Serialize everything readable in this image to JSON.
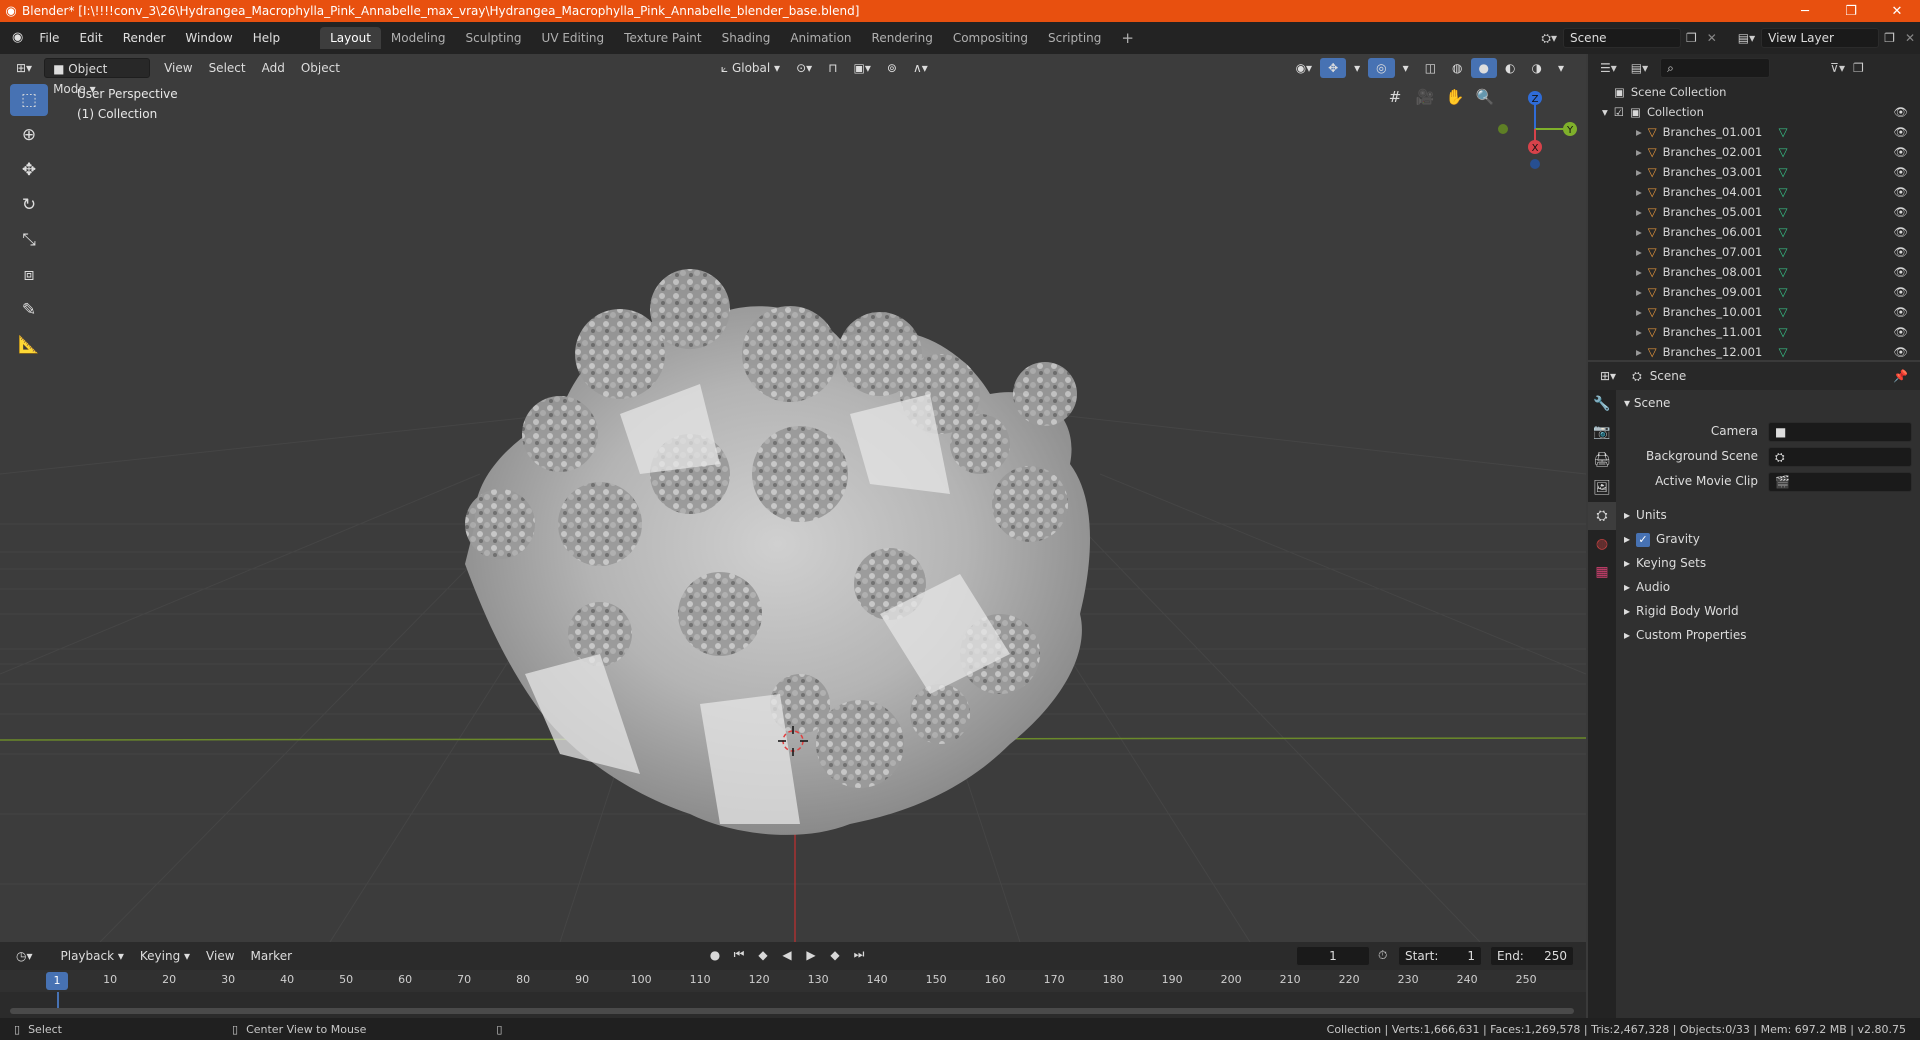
{
  "titlebar": {
    "title": "Blender* [I:\\!!!!conv_3\\26\\Hydrangea_Macrophylla_Pink_Annabelle_max_vray\\Hydrangea_Macrophylla_Pink_Annabelle_blender_base.blend]",
    "accent": "#e8500f"
  },
  "menu": {
    "file": "File",
    "edit": "Edit",
    "render": "Render",
    "window": "Window",
    "help": "Help"
  },
  "workspaces": [
    "Layout",
    "Modeling",
    "Sculpting",
    "UV Editing",
    "Texture Paint",
    "Shading",
    "Animation",
    "Rendering",
    "Compositing",
    "Scripting"
  ],
  "scene_field": "Scene",
  "view_layer_field": "View Layer",
  "viewport": {
    "mode": "Object Mode",
    "view": "View",
    "select": "Select",
    "add": "Add",
    "object": "Object",
    "transform_orientation": "Global",
    "perspective": "User Perspective",
    "collection": "(1) Collection",
    "axes": {
      "x": "X",
      "y": "Y",
      "z": "Z"
    }
  },
  "outliner": {
    "scene_collection": "Scene Collection",
    "collection": "Collection",
    "items": [
      "Branches_01.001",
      "Branches_02.001",
      "Branches_03.001",
      "Branches_04.001",
      "Branches_05.001",
      "Branches_06.001",
      "Branches_07.001",
      "Branches_08.001",
      "Branches_09.001",
      "Branches_10.001",
      "Branches_11.001",
      "Branches_12.001"
    ]
  },
  "properties": {
    "context": "Scene",
    "panel": "Scene",
    "camera_label": "Camera",
    "background_scene_label": "Background Scene",
    "active_movie_clip_label": "Active Movie Clip",
    "sections": [
      "Units",
      "Gravity",
      "Keying Sets",
      "Audio",
      "Rigid Body World",
      "Custom Properties"
    ],
    "gravity_checked": true
  },
  "timeline": {
    "playback": "Playback",
    "keying": "Keying",
    "view": "View",
    "marker": "Marker",
    "current_frame": "1",
    "start_label": "Start:",
    "start": "1",
    "end_label": "End:",
    "end": "250",
    "ticks": [
      "10",
      "20",
      "30",
      "40",
      "50",
      "60",
      "70",
      "80",
      "90",
      "100",
      "110",
      "120",
      "130",
      "140",
      "150",
      "160",
      "170",
      "180",
      "190",
      "200",
      "210",
      "220",
      "230",
      "240",
      "250"
    ],
    "playhead_label": "1"
  },
  "statusbar": {
    "select": "Select",
    "center_view": "Center View to Mouse",
    "stats": "Collection | Verts:1,666,631 | Faces:1,269,578 | Tris:2,467,328 | Objects:0/33 | Mem: 697.2 MB | v2.80.75"
  }
}
